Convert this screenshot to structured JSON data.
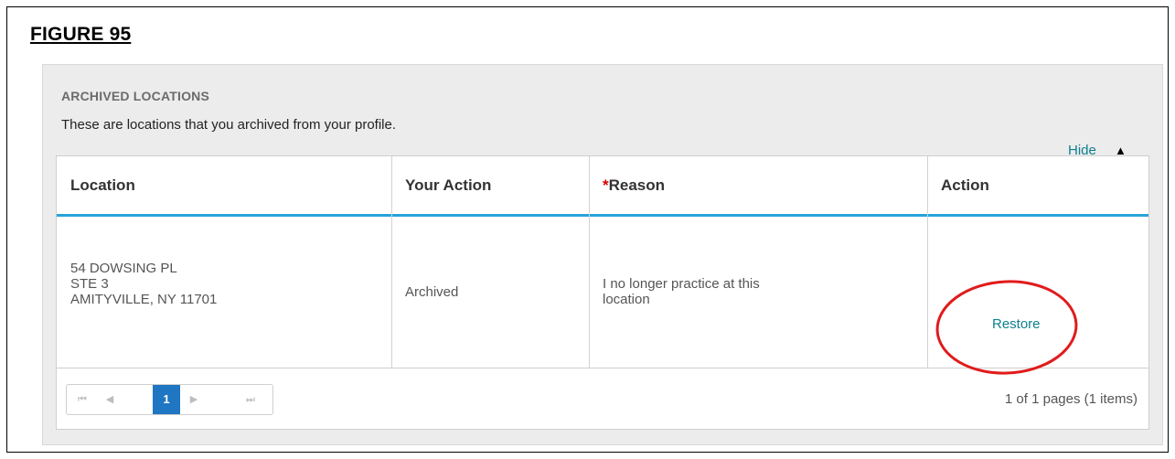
{
  "figure": {
    "title": "FIGURE 95"
  },
  "panel": {
    "heading": "ARCHIVED LOCATIONS",
    "description": "These are locations that you archived from your profile.",
    "hide_label": "Hide",
    "hide_icon": "triangle-up-icon"
  },
  "table": {
    "headers": {
      "location": "Location",
      "your_action": "Your Action",
      "reason_required_marker": "*",
      "reason": "Reason",
      "action": "Action"
    },
    "rows": [
      {
        "location_line1": "54 DOWSING PL",
        "location_line2": "STE 3",
        "location_line3": "AMITYVILLE, NY 11701",
        "your_action": "Archived",
        "reason_line1": "I no longer practice at this",
        "reason_line2": "location",
        "action_label": "Restore"
      }
    ]
  },
  "pager": {
    "first_icon": "first-page-icon",
    "prev_icon": "prev-page-icon",
    "current_page": "1",
    "next_icon": "next-page-icon",
    "last_icon": "last-page-icon",
    "info": "1 of 1 pages (1 items)"
  },
  "colors": {
    "accent_link": "#0d7f8f",
    "header_rule": "#29a3d8",
    "active_page": "#1f76c2",
    "required": "#d60000",
    "annotation_circle": "#e11b1b"
  }
}
